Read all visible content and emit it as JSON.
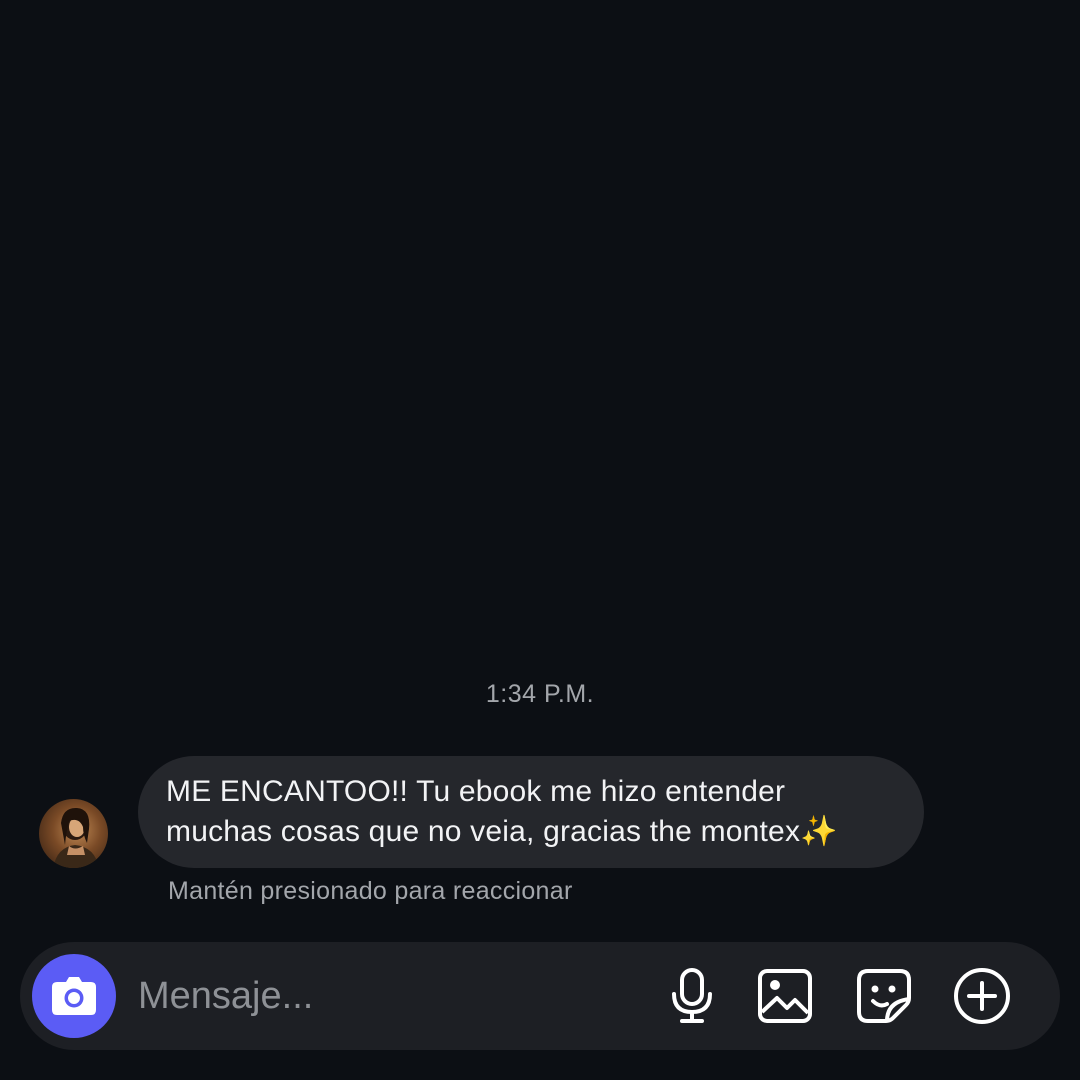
{
  "conversation": {
    "timestamp": "1:34 P.M.",
    "message": {
      "line1": "ME ENCANTOO!! Tu ebook me hizo entender",
      "line2": "muchas cosas que no veia, gracias the montex✨"
    },
    "hint": "Mantén presionado para reaccionar"
  },
  "composer": {
    "placeholder": "Mensaje...",
    "icons": {
      "camera": "camera-icon",
      "mic": "microphone-icon",
      "gallery": "image-icon",
      "sticker": "sticker-icon",
      "plus": "plus-circle-icon"
    },
    "accent_color": "#5b5cf5"
  },
  "theme": {
    "background": "#0c0f14",
    "bubble": "#25272c",
    "composer": "#1d1f24"
  }
}
